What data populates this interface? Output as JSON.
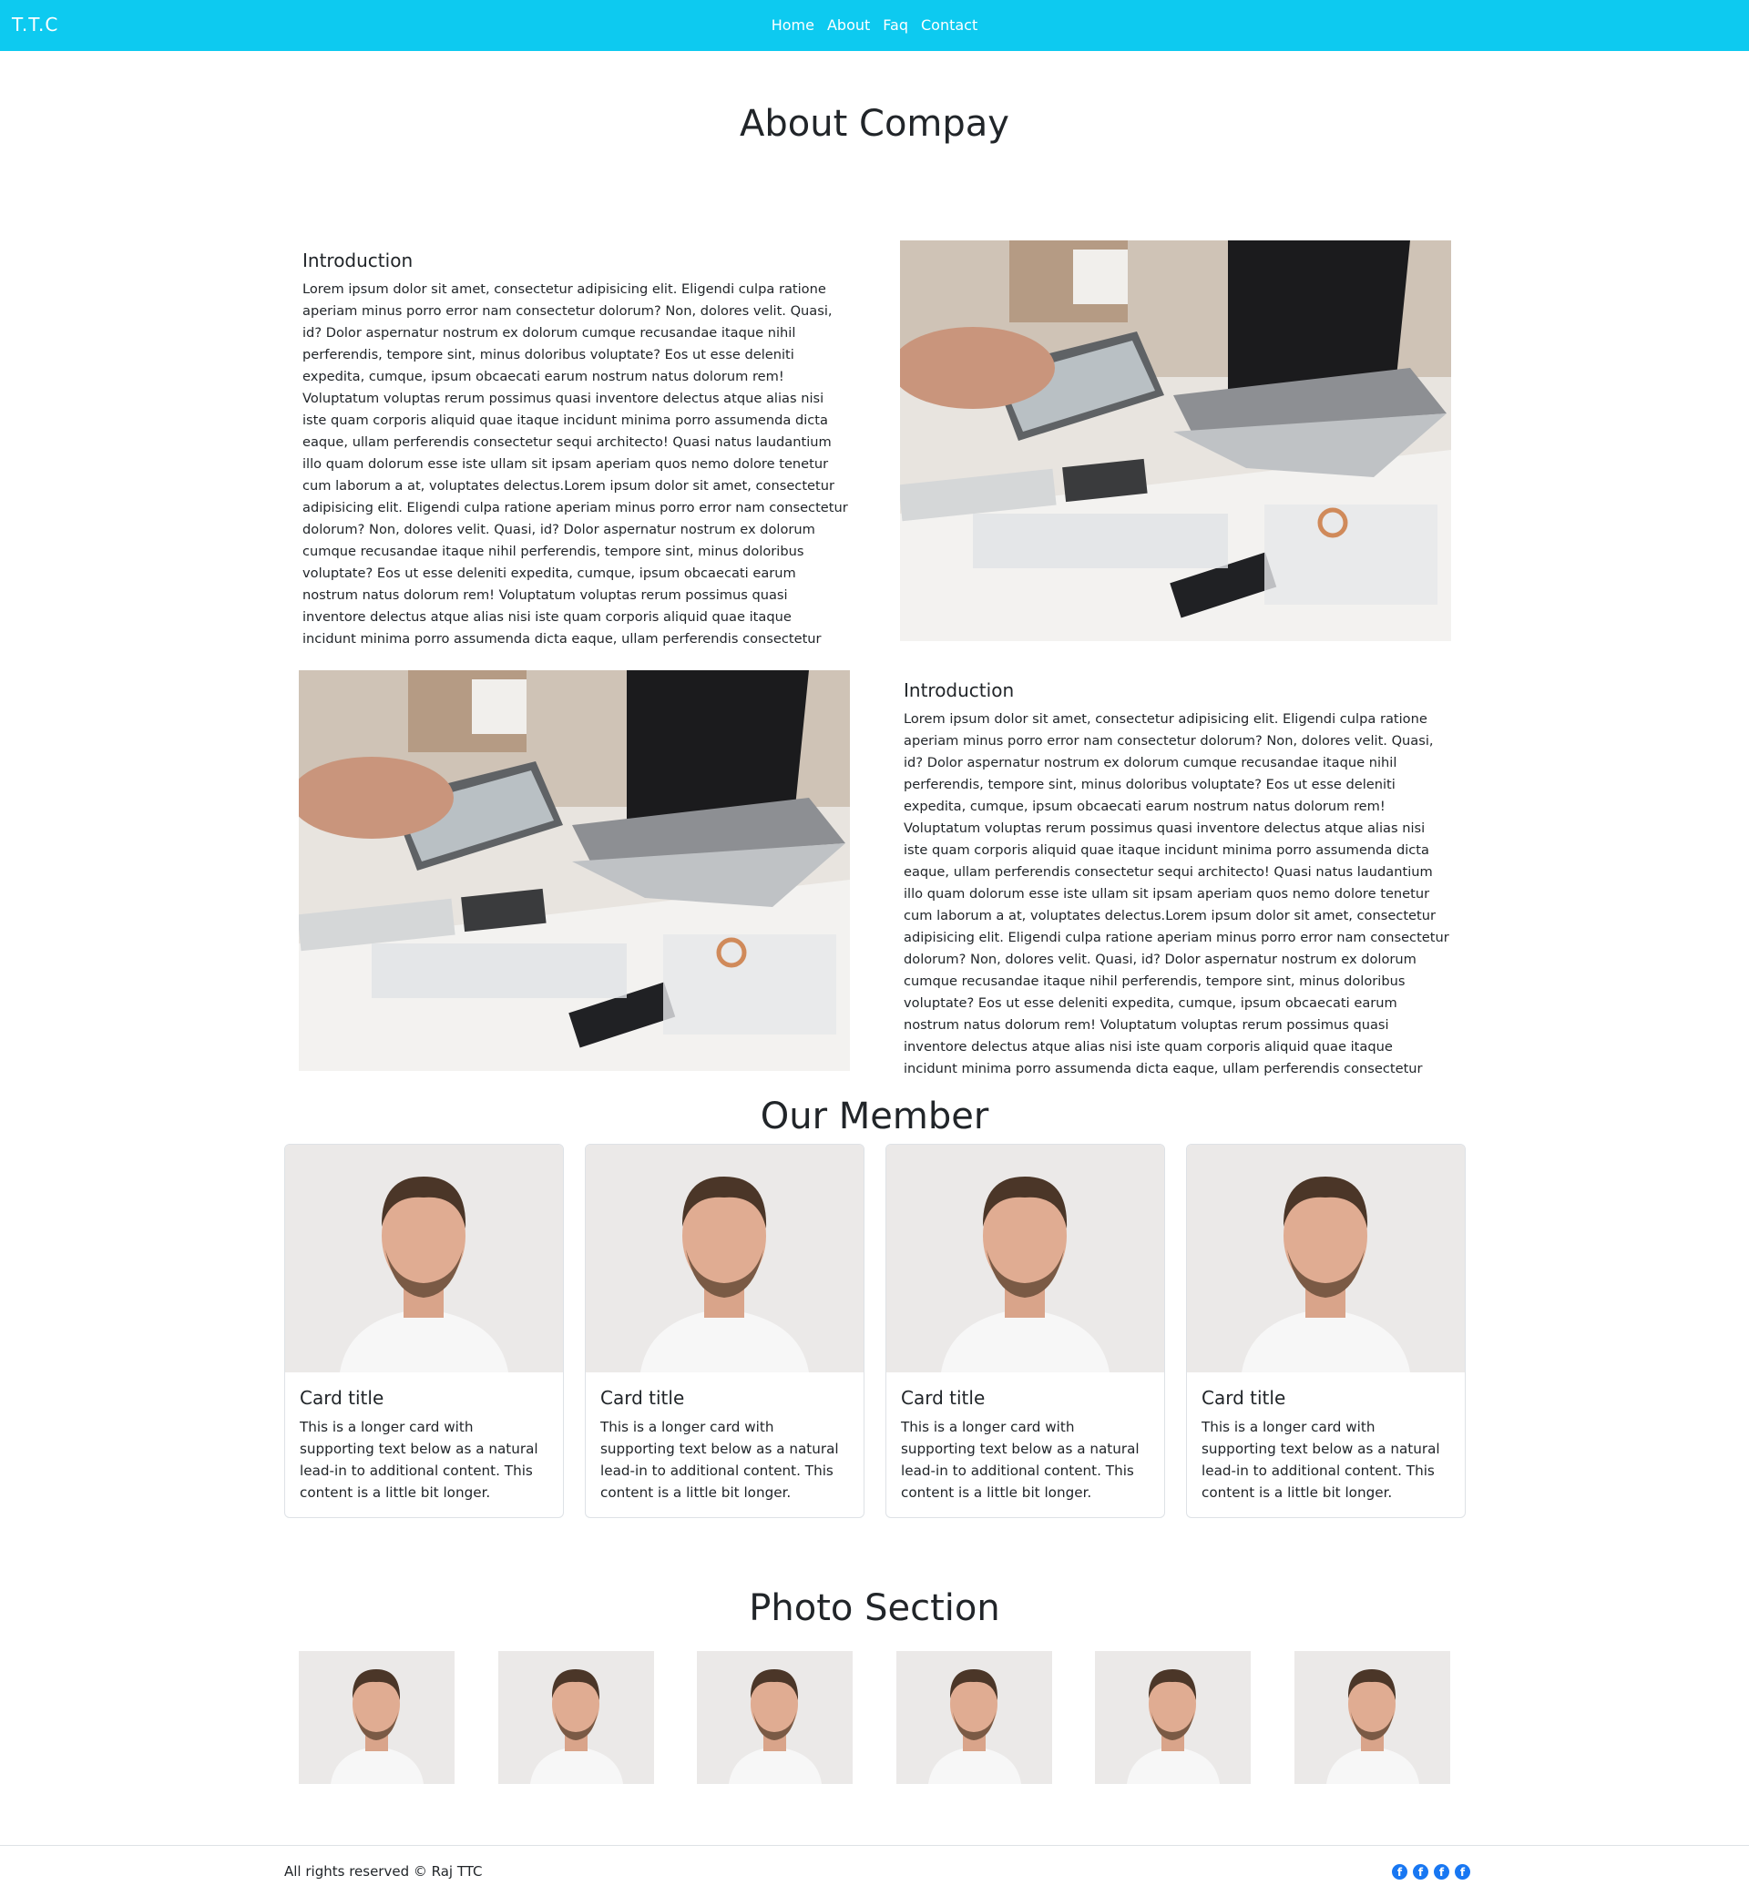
{
  "navbar": {
    "brand": "T.T.C",
    "links": [
      "Home",
      "About",
      "Faq",
      "Contact"
    ]
  },
  "about": {
    "title": "About Compay",
    "blocks": [
      {
        "heading": "Introduction",
        "text": "Lorem ipsum dolor sit amet, consectetur adipisicing elit. Eligendi culpa ratione aperiam minus porro error nam consectetur dolorum? Non, dolores velit. Quasi, id? Dolor aspernatur nostrum ex dolorum cumque recusandae itaque nihil perferendis, tempore sint, minus doloribus voluptate? Eos ut esse deleniti expedita, cumque, ipsum obcaecati earum nostrum natus dolorum rem! Voluptatum voluptas rerum possimus quasi inventore delectus atque alias nisi iste quam corporis aliquid quae itaque incidunt minima porro assumenda dicta eaque, ullam perferendis consectetur sequi architecto! Quasi natus laudantium illo quam dolorum esse iste ullam sit ipsam aperiam quos nemo dolore tenetur cum laborum a at, voluptates delectus.Lorem ipsum dolor sit amet, consectetur adipisicing elit. Eligendi culpa ratione aperiam minus porro error nam consectetur dolorum? Non, dolores velit. Quasi, id? Dolor aspernatur nostrum ex dolorum cumque recusandae itaque nihil perferendis, tempore sint, minus doloribus voluptate? Eos ut esse deleniti expedita, cumque, ipsum obcaecati earum nostrum natus dolorum rem! Voluptatum voluptas rerum possimus quasi inventore delectus atque alias nisi iste quam corporis aliquid quae itaque incidunt minima porro assumenda dicta eaque, ullam perferendis consectetur"
      },
      {
        "heading": "Introduction",
        "text": "Lorem ipsum dolor sit amet, consectetur adipisicing elit. Eligendi culpa ratione aperiam minus porro error nam consectetur dolorum? Non, dolores velit. Quasi, id? Dolor aspernatur nostrum ex dolorum cumque recusandae itaque nihil perferendis, tempore sint, minus doloribus voluptate? Eos ut esse deleniti expedita, cumque, ipsum obcaecati earum nostrum natus dolorum rem! Voluptatum voluptas rerum possimus quasi inventore delectus atque alias nisi iste quam corporis aliquid quae itaque incidunt minima porro assumenda dicta eaque, ullam perferendis consectetur sequi architecto! Quasi natus laudantium illo quam dolorum esse iste ullam sit ipsam aperiam quos nemo dolore tenetur cum laborum a at, voluptates delectus.Lorem ipsum dolor sit amet, consectetur adipisicing elit. Eligendi culpa ratione aperiam minus porro error nam consectetur dolorum? Non, dolores velit. Quasi, id? Dolor aspernatur nostrum ex dolorum cumque recusandae itaque nihil perferendis, tempore sint, minus doloribus voluptate? Eos ut esse deleniti expedita, cumque, ipsum obcaecati earum nostrum natus dolorum rem! Voluptatum voluptas rerum possimus quasi inventore delectus atque alias nisi iste quam corporis aliquid quae itaque incidunt minima porro assumenda dicta eaque, ullam perferendis consectetur"
      }
    ]
  },
  "members": {
    "title": "Our Member",
    "cards": [
      {
        "title": "Card title",
        "text": "This is a longer card with supporting text below as a natural lead-in to additional content. This content is a little bit longer."
      },
      {
        "title": "Card title",
        "text": "This is a longer card with supporting text below as a natural lead-in to additional content. This content is a little bit longer."
      },
      {
        "title": "Card title",
        "text": "This is a longer card with supporting text below as a natural lead-in to additional content. This content is a little bit longer."
      },
      {
        "title": "Card title",
        "text": "This is a longer card with supporting text below as a natural lead-in to additional content. This content is a little bit longer."
      }
    ]
  },
  "photos": {
    "title": "Photo Section",
    "count": 6
  },
  "footer": {
    "text": "All rights reserved © Raj TTC",
    "social_icons": [
      "facebook-icon",
      "facebook-icon",
      "facebook-icon",
      "facebook-icon"
    ],
    "social_glyph": "f"
  },
  "colors": {
    "navbar": "#0dcaf0",
    "text": "#212529",
    "facebook": "#1877f2"
  }
}
